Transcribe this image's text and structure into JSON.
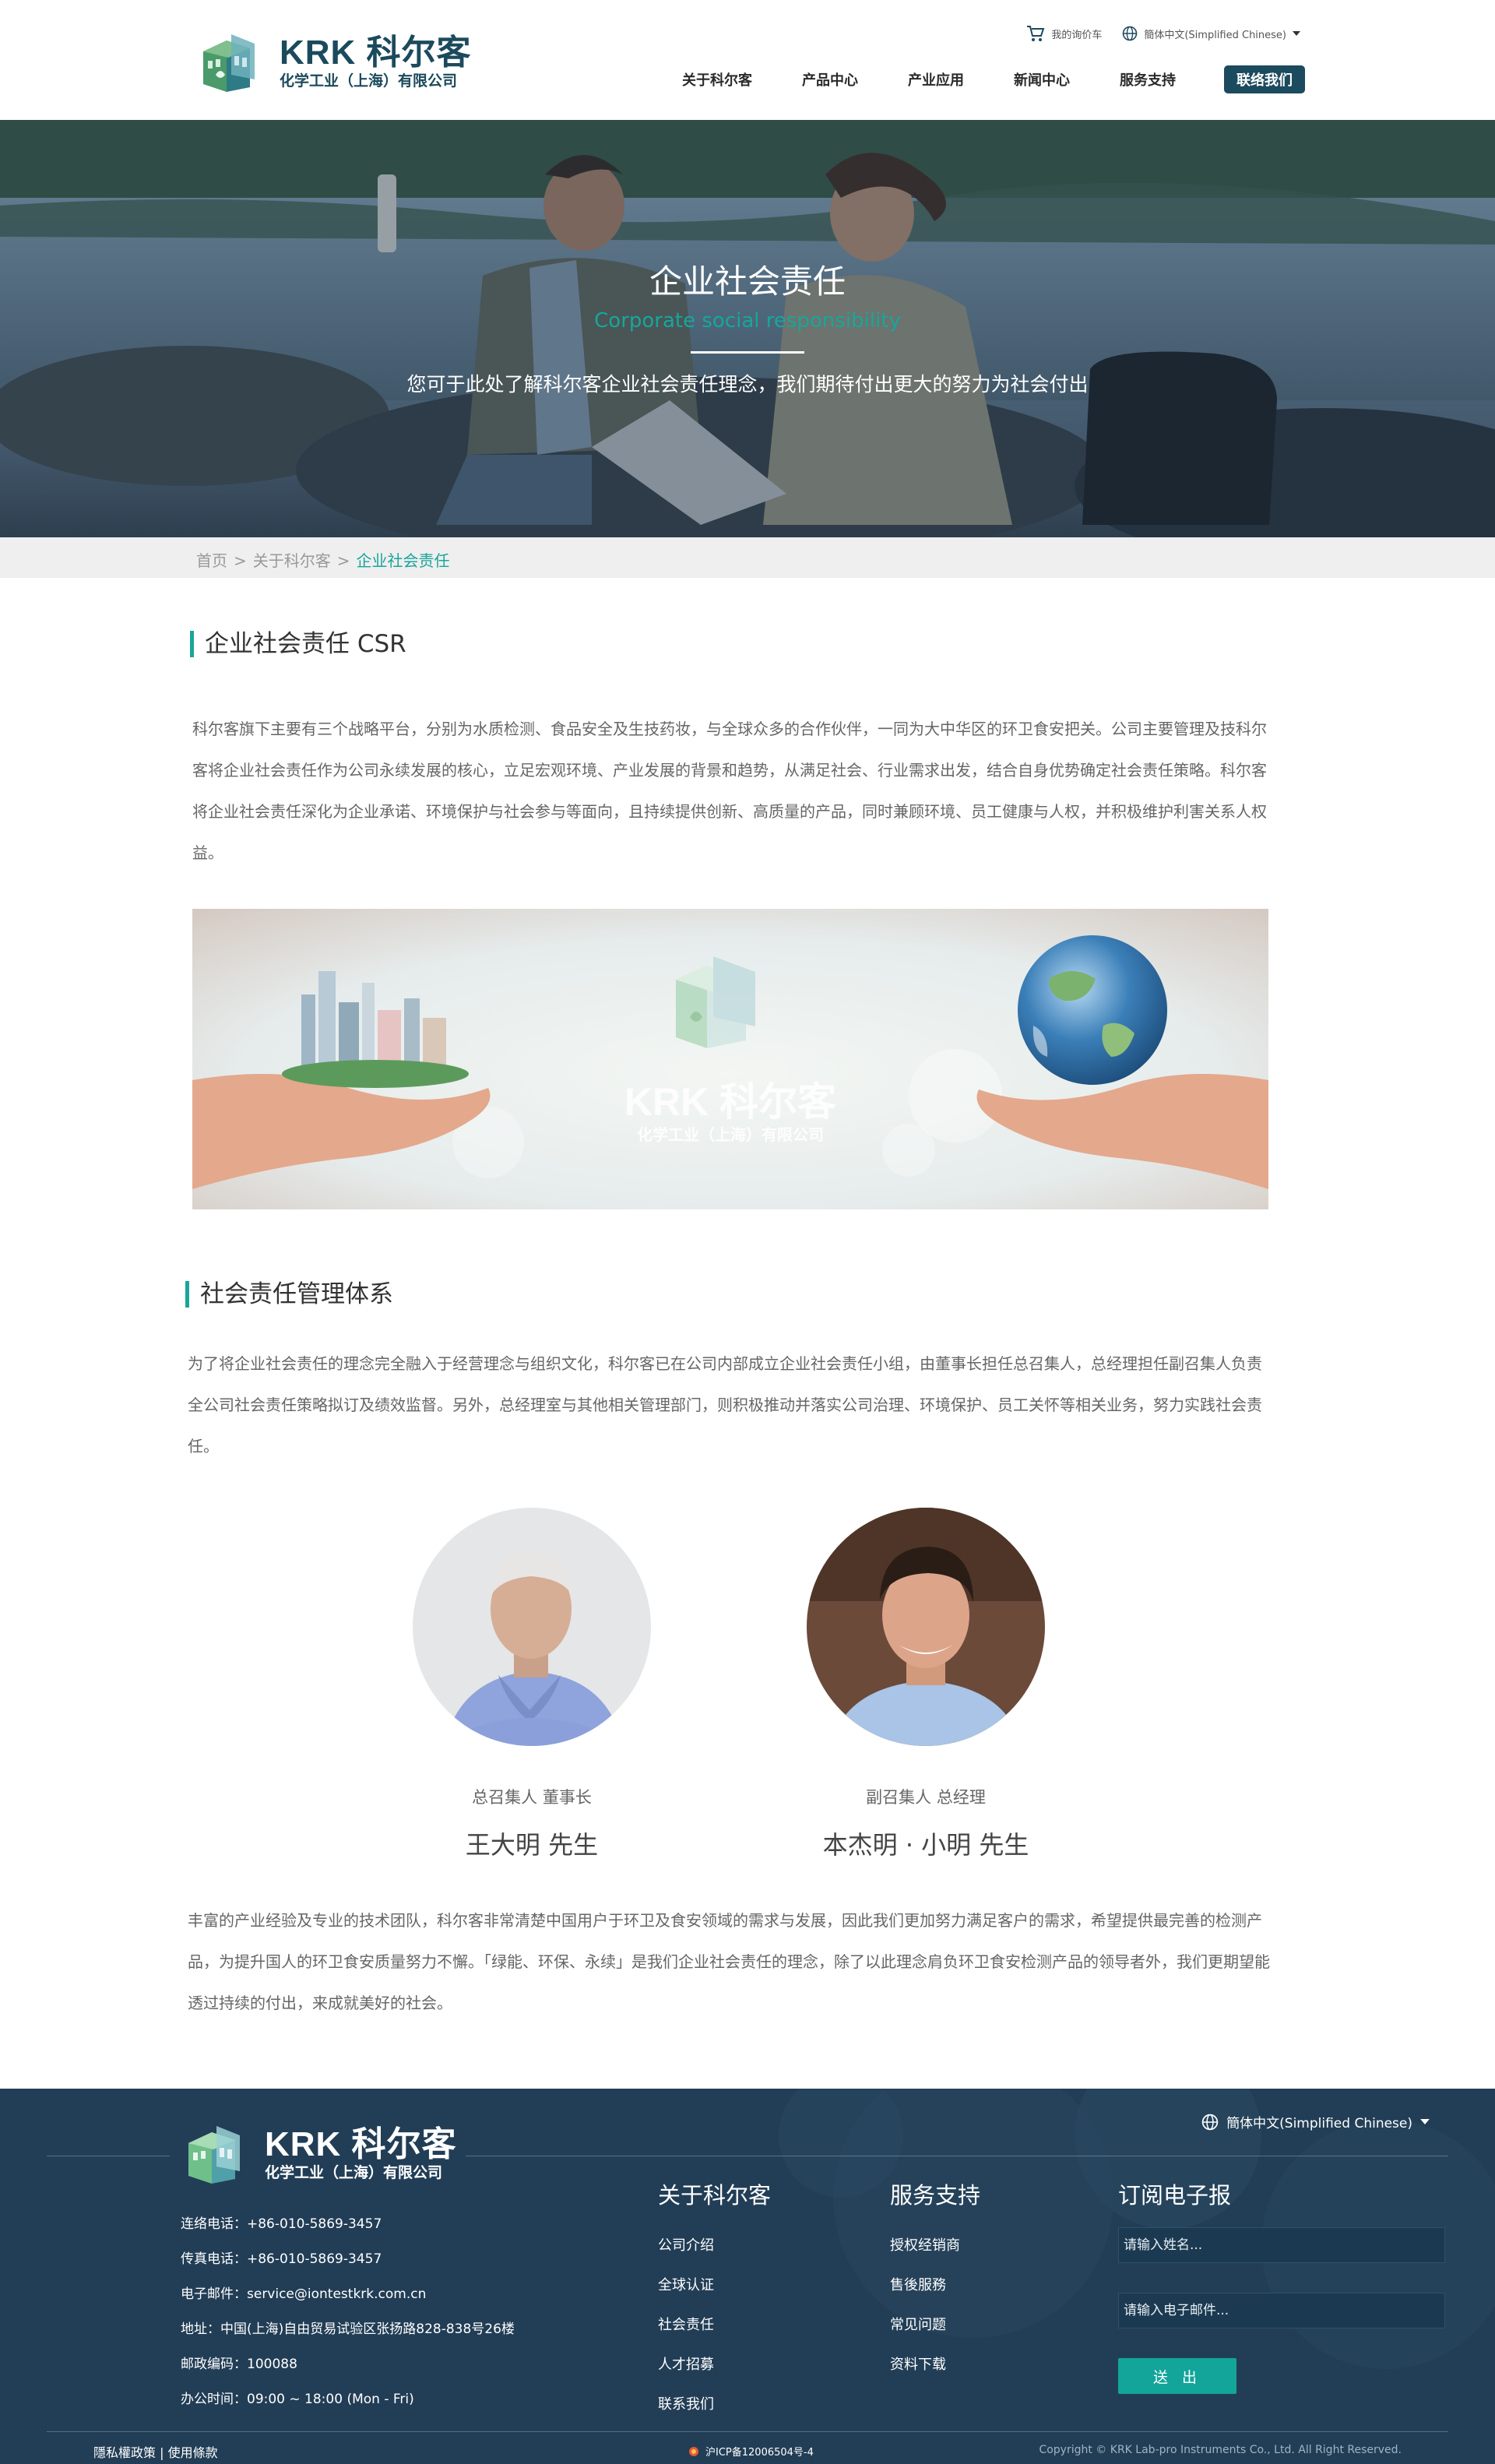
{
  "header": {
    "logo": {
      "brand": "KRK 科尔客",
      "company": "化学工业（上海）有限公司"
    },
    "util": {
      "inquiry_cart": "我的询价车",
      "language": "簡体中文(Simplified Chinese)"
    },
    "nav": [
      "关于科尔客",
      "产品中心",
      "产业应用",
      "新闻中心",
      "服务支持"
    ],
    "contact_button": "联络我们"
  },
  "hero": {
    "title": "企业社会责任",
    "subtitle_en": "Corporate social responsibility",
    "description": "您可于此处了解科尔客企业社会责任理念，我们期待付出更大的努力为社会付出"
  },
  "breadcrumb": {
    "home": "首页",
    "about": "关于科尔客",
    "current": "企业社会责任",
    "separator": ">"
  },
  "csr": {
    "heading": "企业社会责任 CSR",
    "paragraph": "科尔客旗下主要有三个战略平台，分别为水质检测、食品安全及生技药妆，与全球众多的合作伙伴，一同为大中华区的环卫食安把关。公司主要管理及技科尔客将企业社会责任作为公司永续发展的核心，立足宏观环境、产业发展的背景和趋势，从满足社会、行业需求出发，结合自身优势确定社会责任策略。科尔客将企业社会责任深化为企业承诺、环境保护与社会参与等面向，且持续提供创新、高质量的产品，同时兼顾环境、员工健康与人权，并积极维护利害关系人权益。",
    "banner": {
      "brand": "KRK 科尔客",
      "company": "化学工业（上海）有限公司"
    }
  },
  "management": {
    "heading": "社会责任管理体系",
    "paragraph": "为了将企业社会责任的理念完全融入于经营理念与组织文化，科尔客已在公司内部成立企业社会责任小组，由董事长担任总召集人，总经理担任副召集人负责全公司社会责任策略拟订及绩效监督。另外，总经理室与其他相关管理部门，则积极推动并落实公司治理、环境保护、员工关怀等相关业务，努力实践社会责任。",
    "people": [
      {
        "role": "总召集人 董事长",
        "name": "王大明 先生"
      },
      {
        "role": "副召集人 总经理",
        "name": "本杰明 · 小明 先生"
      }
    ],
    "closing": "丰富的产业经验及专业的技术团队，科尔客非常清楚中国用户于环卫及食安领域的需求与发展，因此我们更加努力满足客户的需求，希望提供最完善的检测产品，为提升国人的环卫食安质量努力不懈。「绿能、环保、永续」是我们企业社会责任的理念，除了以此理念肩负环卫食安检测产品的领导者外，我们更期望能透过持续的付出，来成就美好的社会。"
  },
  "footer": {
    "logo": {
      "brand": "KRK 科尔客",
      "company": "化学工业（上海）有限公司"
    },
    "language": "簡体中文(Simplified Chinese)",
    "contact": [
      "连络电话：+86-010-5869-3457",
      "传真电话：+86-010-5869-3457",
      "电子邮件：service@iontestkrk.com.cn",
      "地址：中国(上海)自由贸易试验区张扬路828-838号26楼",
      "邮政编码：100088",
      "办公时间：09:00 ~ 18:00 (Mon - Fri)"
    ],
    "about": {
      "title": "关于科尔客",
      "items": [
        "公司介绍",
        "全球认证",
        "社会责任",
        "人才招募",
        "联系我们"
      ]
    },
    "service": {
      "title": "服务支持",
      "items": [
        "授权经销商",
        "售後服務",
        "常见问题",
        "资料下载"
      ]
    },
    "newsletter": {
      "title": "订阅电子报",
      "name_placeholder": "请输入姓名...",
      "email_placeholder": "请输入电子邮件...",
      "send": "送 出"
    },
    "bottom": {
      "policy": "隱私權政策 | 使用條款",
      "icp": "沪ICP备12006504号-4",
      "copyright": "Copyright © KRK Lab-pro Instruments Co., Ltd. All Right Reserved."
    }
  },
  "colors": {
    "accent": "#1aa59a",
    "navy": "#1c4a5e",
    "footer_bg": "#223e56"
  }
}
